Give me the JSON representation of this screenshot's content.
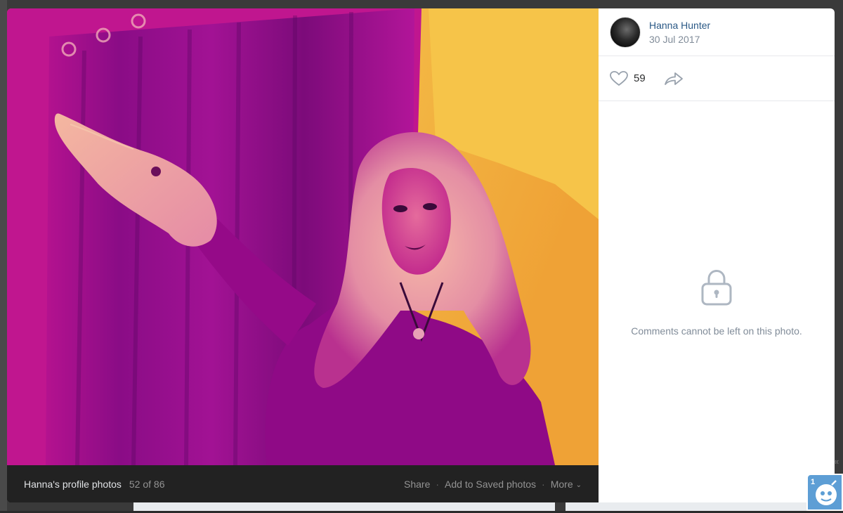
{
  "author": {
    "name": "Hanna Hunter",
    "date": "30 Jul 2017"
  },
  "actions": {
    "like_count": "59"
  },
  "comments": {
    "locked_message": "Comments cannot be left on this photo."
  },
  "footer": {
    "album_title": "Hanna's profile photos",
    "counter": "52 of 86",
    "share_label": "Share",
    "save_label": "Add to Saved photos",
    "more_label": "More"
  },
  "widget": {
    "badge": "1"
  },
  "icons": {
    "like": "heart-icon",
    "share": "share-arrow-icon",
    "lock": "lock-icon",
    "more": "chevron-down-icon",
    "edge": "double-chevron-left-icon"
  },
  "colors": {
    "link": "#2a5885",
    "muted": "#818c99",
    "footer_bg": "#222222",
    "photo_magenta": "#c2189a",
    "photo_yellow": "#f4c23a"
  }
}
